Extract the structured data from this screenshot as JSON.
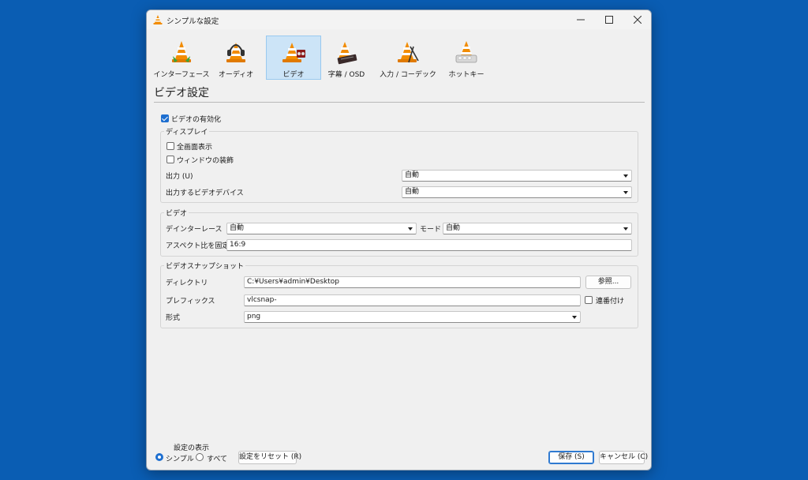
{
  "window": {
    "title": "シンプルな設定"
  },
  "categories": [
    {
      "label": "インターフェース",
      "icon": "interface-icon"
    },
    {
      "label": "オーディオ",
      "icon": "audio-icon"
    },
    {
      "label": "ビデオ",
      "icon": "video-icon",
      "active": true
    },
    {
      "label": "字幕 / OSD",
      "icon": "subtitles-icon"
    },
    {
      "label": "入力 / コーデック",
      "icon": "input-codec-icon"
    },
    {
      "label": "ホットキー",
      "icon": "hotkeys-icon"
    }
  ],
  "page": {
    "title": "ビデオ設定",
    "enable_video": {
      "label": "ビデオの有効化",
      "checked": true
    }
  },
  "display": {
    "title": "ディスプレイ",
    "fullscreen": {
      "label": "全画面表示",
      "checked": false
    },
    "decorations": {
      "label": "ウィンドウの装飾",
      "checked": false
    },
    "output_label": "出力 (U)",
    "output_value": "自動",
    "device_label": "出力するビデオデバイス",
    "device_value": "自動"
  },
  "video": {
    "title": "ビデオ",
    "deinterlace_label": "デインターレース",
    "deinterlace_value": "自動",
    "mode_label": "モード",
    "mode_value": "自動",
    "aspect_label": "アスペクト比を固定",
    "aspect_value": "16:9"
  },
  "snapshot": {
    "title": "ビデオスナップショット",
    "dir_label": "ディレクトリ",
    "dir_value": "C:¥Users¥admin¥Desktop",
    "browse_label": "参照...",
    "prefix_label": "プレフィックス",
    "prefix_value": "vlcsnap-",
    "sequential_label": "連番付け",
    "sequential_checked": false,
    "format_label": "形式",
    "format_value": "png"
  },
  "footer": {
    "show_settings_label": "設定の表示",
    "simple_label": "シンプル",
    "all_label": "すべて",
    "reset_label": "設定をリセット (R)",
    "save_label": "保存 (S)",
    "cancel_label": "キャンセル (C)"
  },
  "colors": {
    "accent": "#1e6fd0",
    "cone_orange": "#f28c00",
    "desktop": "#0a5db3"
  }
}
